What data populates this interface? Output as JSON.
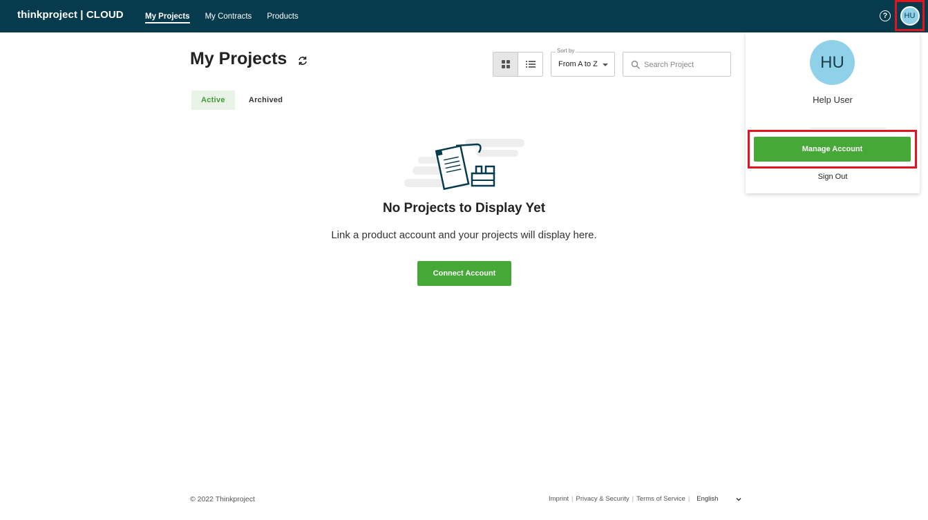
{
  "brand": "thinkproject | CLOUD",
  "nav": {
    "items": [
      {
        "label": "My Projects"
      },
      {
        "label": "My Contracts"
      },
      {
        "label": "Products"
      }
    ]
  },
  "user": {
    "initials": "HU",
    "name": "Help User"
  },
  "page": {
    "title": "My Projects",
    "sort": {
      "label": "Sort by",
      "value": "From A to Z"
    },
    "search_placeholder": "Search Project",
    "tabs": [
      {
        "label": "Active"
      },
      {
        "label": "Archived"
      }
    ]
  },
  "empty_state": {
    "title": "No Projects to Display Yet",
    "subtitle": "Link a product account and your projects will display here.",
    "button": "Connect Account"
  },
  "dropdown": {
    "manage": "Manage Account",
    "signout": "Sign Out"
  },
  "footer": {
    "copyright": "© 2022 Thinkproject",
    "links": [
      "Imprint",
      "Privacy & Security",
      "Terms of Service"
    ],
    "language": "English"
  },
  "colors": {
    "topbar": "#053b4d",
    "accent_green": "#46a837",
    "avatar": "#8fd1e8",
    "highlight_red": "#e4141e"
  }
}
